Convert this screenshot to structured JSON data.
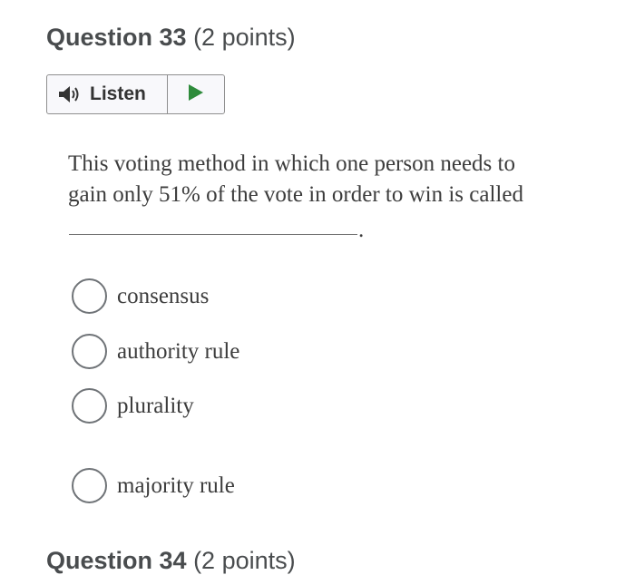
{
  "question": {
    "number_label": "Question 33",
    "points_label": "(2 points)"
  },
  "listen": {
    "label": "Listen",
    "colors": {
      "play": "#2e8b3b",
      "speaker": "#333333"
    }
  },
  "prompt": {
    "line1": "This voting method in which one person needs to",
    "line2": "gain only 51% of the vote in order to win is called",
    "blank_end": "."
  },
  "options": [
    {
      "label": "consensus",
      "selected": false
    },
    {
      "label": "authority rule",
      "selected": false
    },
    {
      "label": "plurality",
      "selected": false
    },
    {
      "label": "majority rule",
      "selected": false
    }
  ],
  "next_question": {
    "number_label": "Question 34",
    "points_label": "(2 points)"
  }
}
